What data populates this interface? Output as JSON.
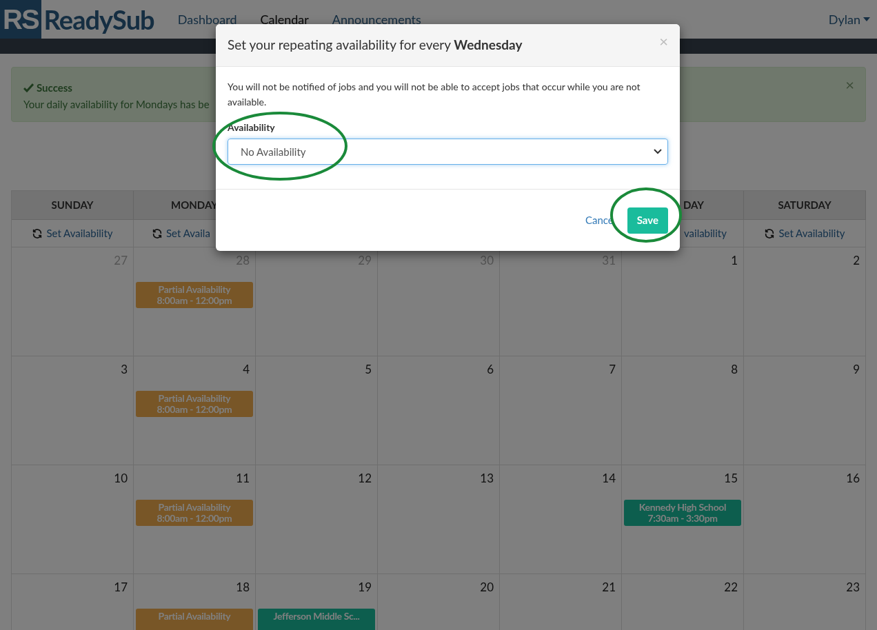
{
  "nav": {
    "logo_mark": "RS",
    "logo_text": "ReadySub",
    "links": [
      {
        "label": "Dashboard",
        "selected": false
      },
      {
        "label": "Calendar",
        "selected": true
      },
      {
        "label": "Announcements",
        "selected": false
      }
    ],
    "user": "Dylan"
  },
  "alert": {
    "title": "Success",
    "message": "Your daily availability for Mondays has be",
    "close": "×"
  },
  "calendar": {
    "headers_left": [
      "SUNDAY",
      "MONDAY"
    ],
    "headers_right": [
      "DAY",
      "SATURDAY"
    ],
    "set_row_left": [
      "Set Availability",
      "Set Availa"
    ],
    "set_row_right": [
      "vailability",
      "Set Availability"
    ],
    "weeks": [
      [
        {
          "day": "27",
          "other_month": true
        },
        {
          "day": "28",
          "other_month": true,
          "events": [
            {
              "kind": "partial",
              "title": "Partial Availability",
              "time": "8:00am - 12:00pm"
            }
          ]
        },
        {
          "day": "29",
          "other_month": true
        },
        {
          "day": "30",
          "other_month": true
        },
        {
          "day": "31",
          "other_month": true
        },
        {
          "day": "1",
          "other_month": false
        },
        {
          "day": "2",
          "other_month": false
        }
      ],
      [
        {
          "day": "3",
          "other_month": false
        },
        {
          "day": "4",
          "other_month": false,
          "events": [
            {
              "kind": "partial",
              "title": "Partial Availability",
              "time": "8:00am - 12:00pm"
            }
          ]
        },
        {
          "day": "5",
          "other_month": false
        },
        {
          "day": "6",
          "other_month": false
        },
        {
          "day": "7",
          "other_month": false
        },
        {
          "day": "8",
          "other_month": false
        },
        {
          "day": "9",
          "other_month": false
        }
      ],
      [
        {
          "day": "10",
          "other_month": false
        },
        {
          "day": "11",
          "other_month": false,
          "events": [
            {
              "kind": "partial",
              "title": "Partial Availability",
              "time": "8:00am - 12:00pm"
            }
          ]
        },
        {
          "day": "12",
          "other_month": false
        },
        {
          "day": "13",
          "other_month": false
        },
        {
          "day": "14",
          "other_month": false
        },
        {
          "day": "15",
          "other_month": false,
          "events": [
            {
              "kind": "job",
              "title": "Kennedy High School",
              "time": "7:30am - 3:30pm"
            }
          ]
        },
        {
          "day": "16",
          "other_month": false
        }
      ],
      [
        {
          "day": "17",
          "other_month": false
        },
        {
          "day": "18",
          "other_month": false,
          "events": [
            {
              "kind": "partial",
              "title": "Partial Availability"
            }
          ]
        },
        {
          "day": "19",
          "other_month": false,
          "events": [
            {
              "kind": "job",
              "title": "Jefferson Middle Sc..."
            }
          ]
        },
        {
          "day": "20",
          "other_month": false
        },
        {
          "day": "21",
          "other_month": false
        },
        {
          "day": "22",
          "other_month": false
        },
        {
          "day": "23",
          "other_month": false
        }
      ]
    ]
  },
  "modal": {
    "title": "Set your repeating availability for every **Wednesday**",
    "close": "×",
    "body": "You will not be notified of jobs and you will not be able to accept jobs that occur while you are not available.",
    "field_label": "Availability",
    "select_value": "No Availability",
    "cancel": "Cance",
    "save": "Save"
  }
}
